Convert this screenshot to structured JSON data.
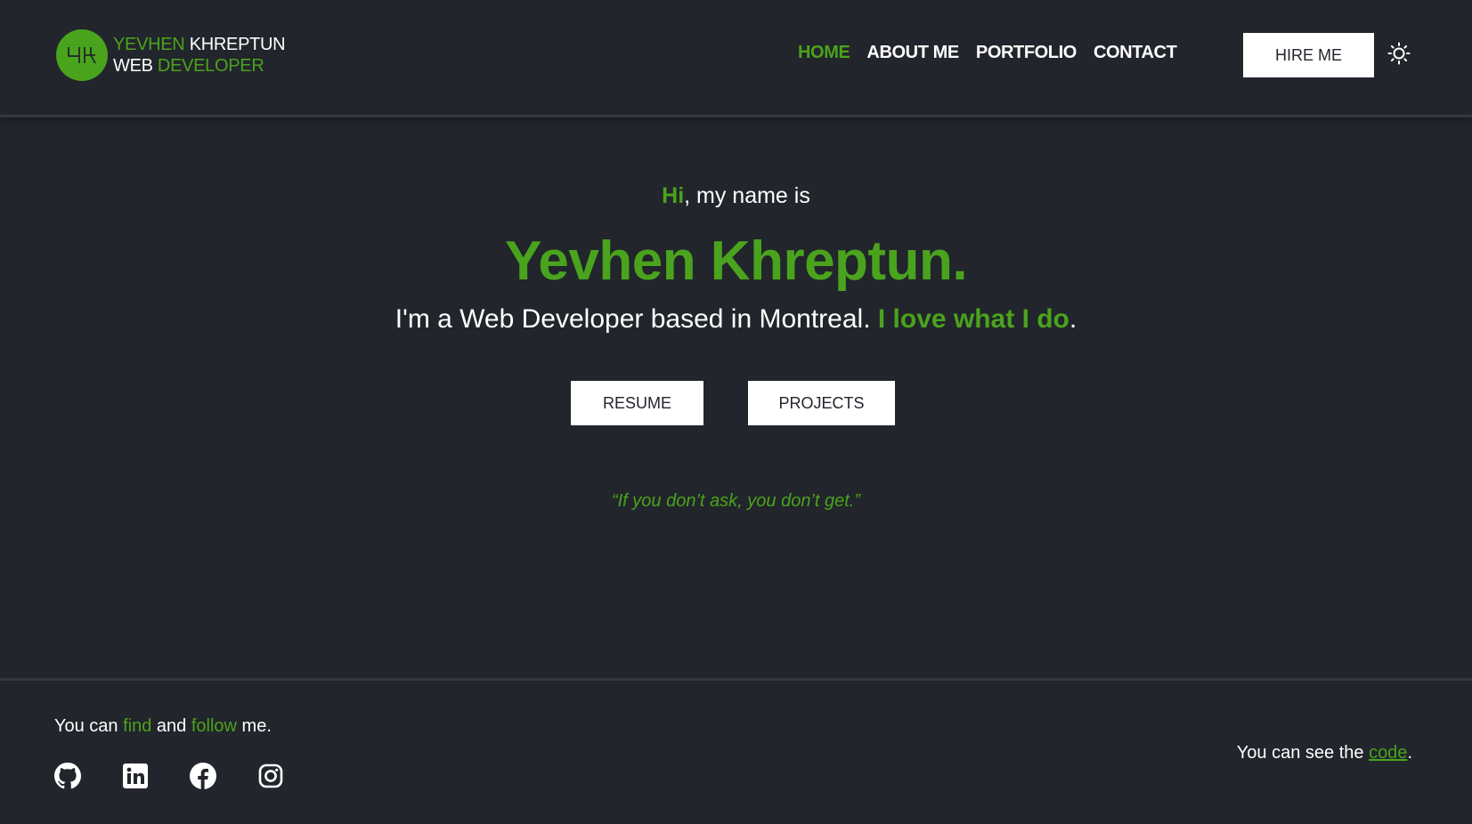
{
  "header": {
    "logo": {
      "monogram": "YK",
      "line1_first": "YEVHEN",
      "line1_second": " KHREPTUN",
      "line2_first": "WEB ",
      "line2_second": "DEVELOPER"
    },
    "nav": [
      {
        "label": "HOME",
        "active": true
      },
      {
        "label": "ABOUT ME",
        "active": false
      },
      {
        "label": "PORTFOLIO",
        "active": false
      },
      {
        "label": "CONTACT",
        "active": false
      }
    ],
    "hire_label": "HIRE ME",
    "theme_icon": "sun-icon"
  },
  "hero": {
    "greeting_hi": "Hi",
    "greeting_rest": ", my name is",
    "name": "Yevhen Khreptun.",
    "tagline_plain": "I'm a Web Developer based in Montreal. ",
    "tagline_accent": "I love what I do",
    "tagline_end": ".",
    "resume_label": "RESUME",
    "projects_label": "PROJECTS",
    "quote": "“If you don’t ask, you don’t get.”"
  },
  "footer": {
    "follow_a": "You can ",
    "follow_find": "find",
    "follow_b": " and ",
    "follow_follow": "follow",
    "follow_c": " me.",
    "socials": [
      "github-icon",
      "linkedin-icon",
      "facebook-icon",
      "instagram-icon"
    ],
    "code_prefix": "You can see the ",
    "code_link": "code",
    "code_suffix": "."
  },
  "colors": {
    "background": "#22252b",
    "accent": "#4aa31d",
    "text": "#ffffff"
  }
}
